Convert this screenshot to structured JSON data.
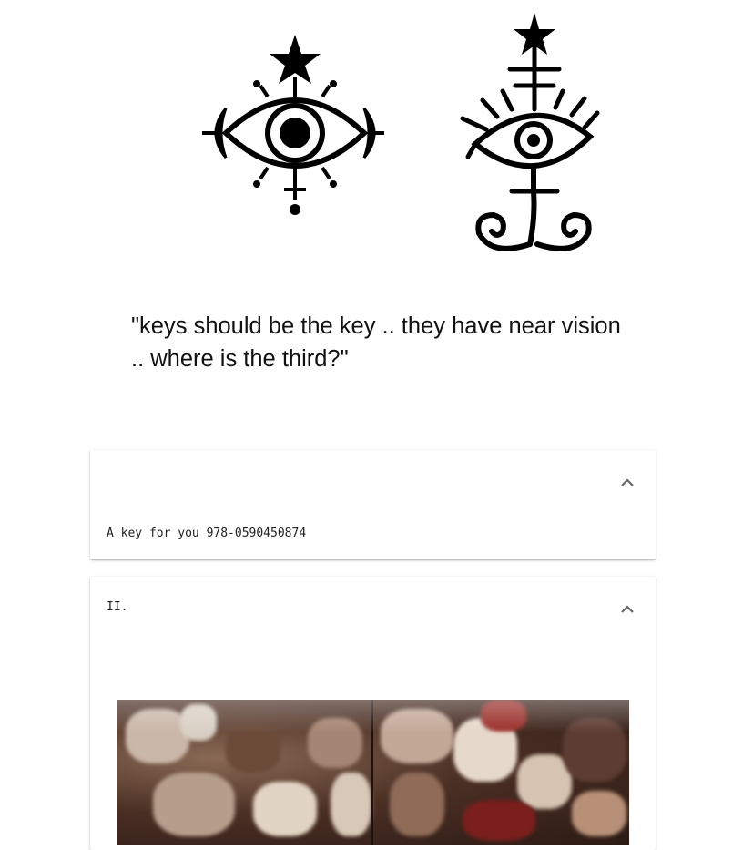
{
  "symbols": {
    "left_icon": "eye-with-star-sigil-icon",
    "right_icon": "eye-with-star-and-spirals-sigil-icon"
  },
  "quote": {
    "text": "\"keys should be the key .. they have near vision .. where is the third?\""
  },
  "cards": [
    {
      "title": "",
      "body": "A key for you 978-0590450874",
      "toggle_icon": "chevron-up-icon"
    },
    {
      "title": "II.",
      "toggle_icon": "chevron-up-icon",
      "image": "collage-photo"
    }
  ],
  "colors": {
    "ink": "#000000",
    "text": "#111111",
    "chevron": "#666666"
  }
}
